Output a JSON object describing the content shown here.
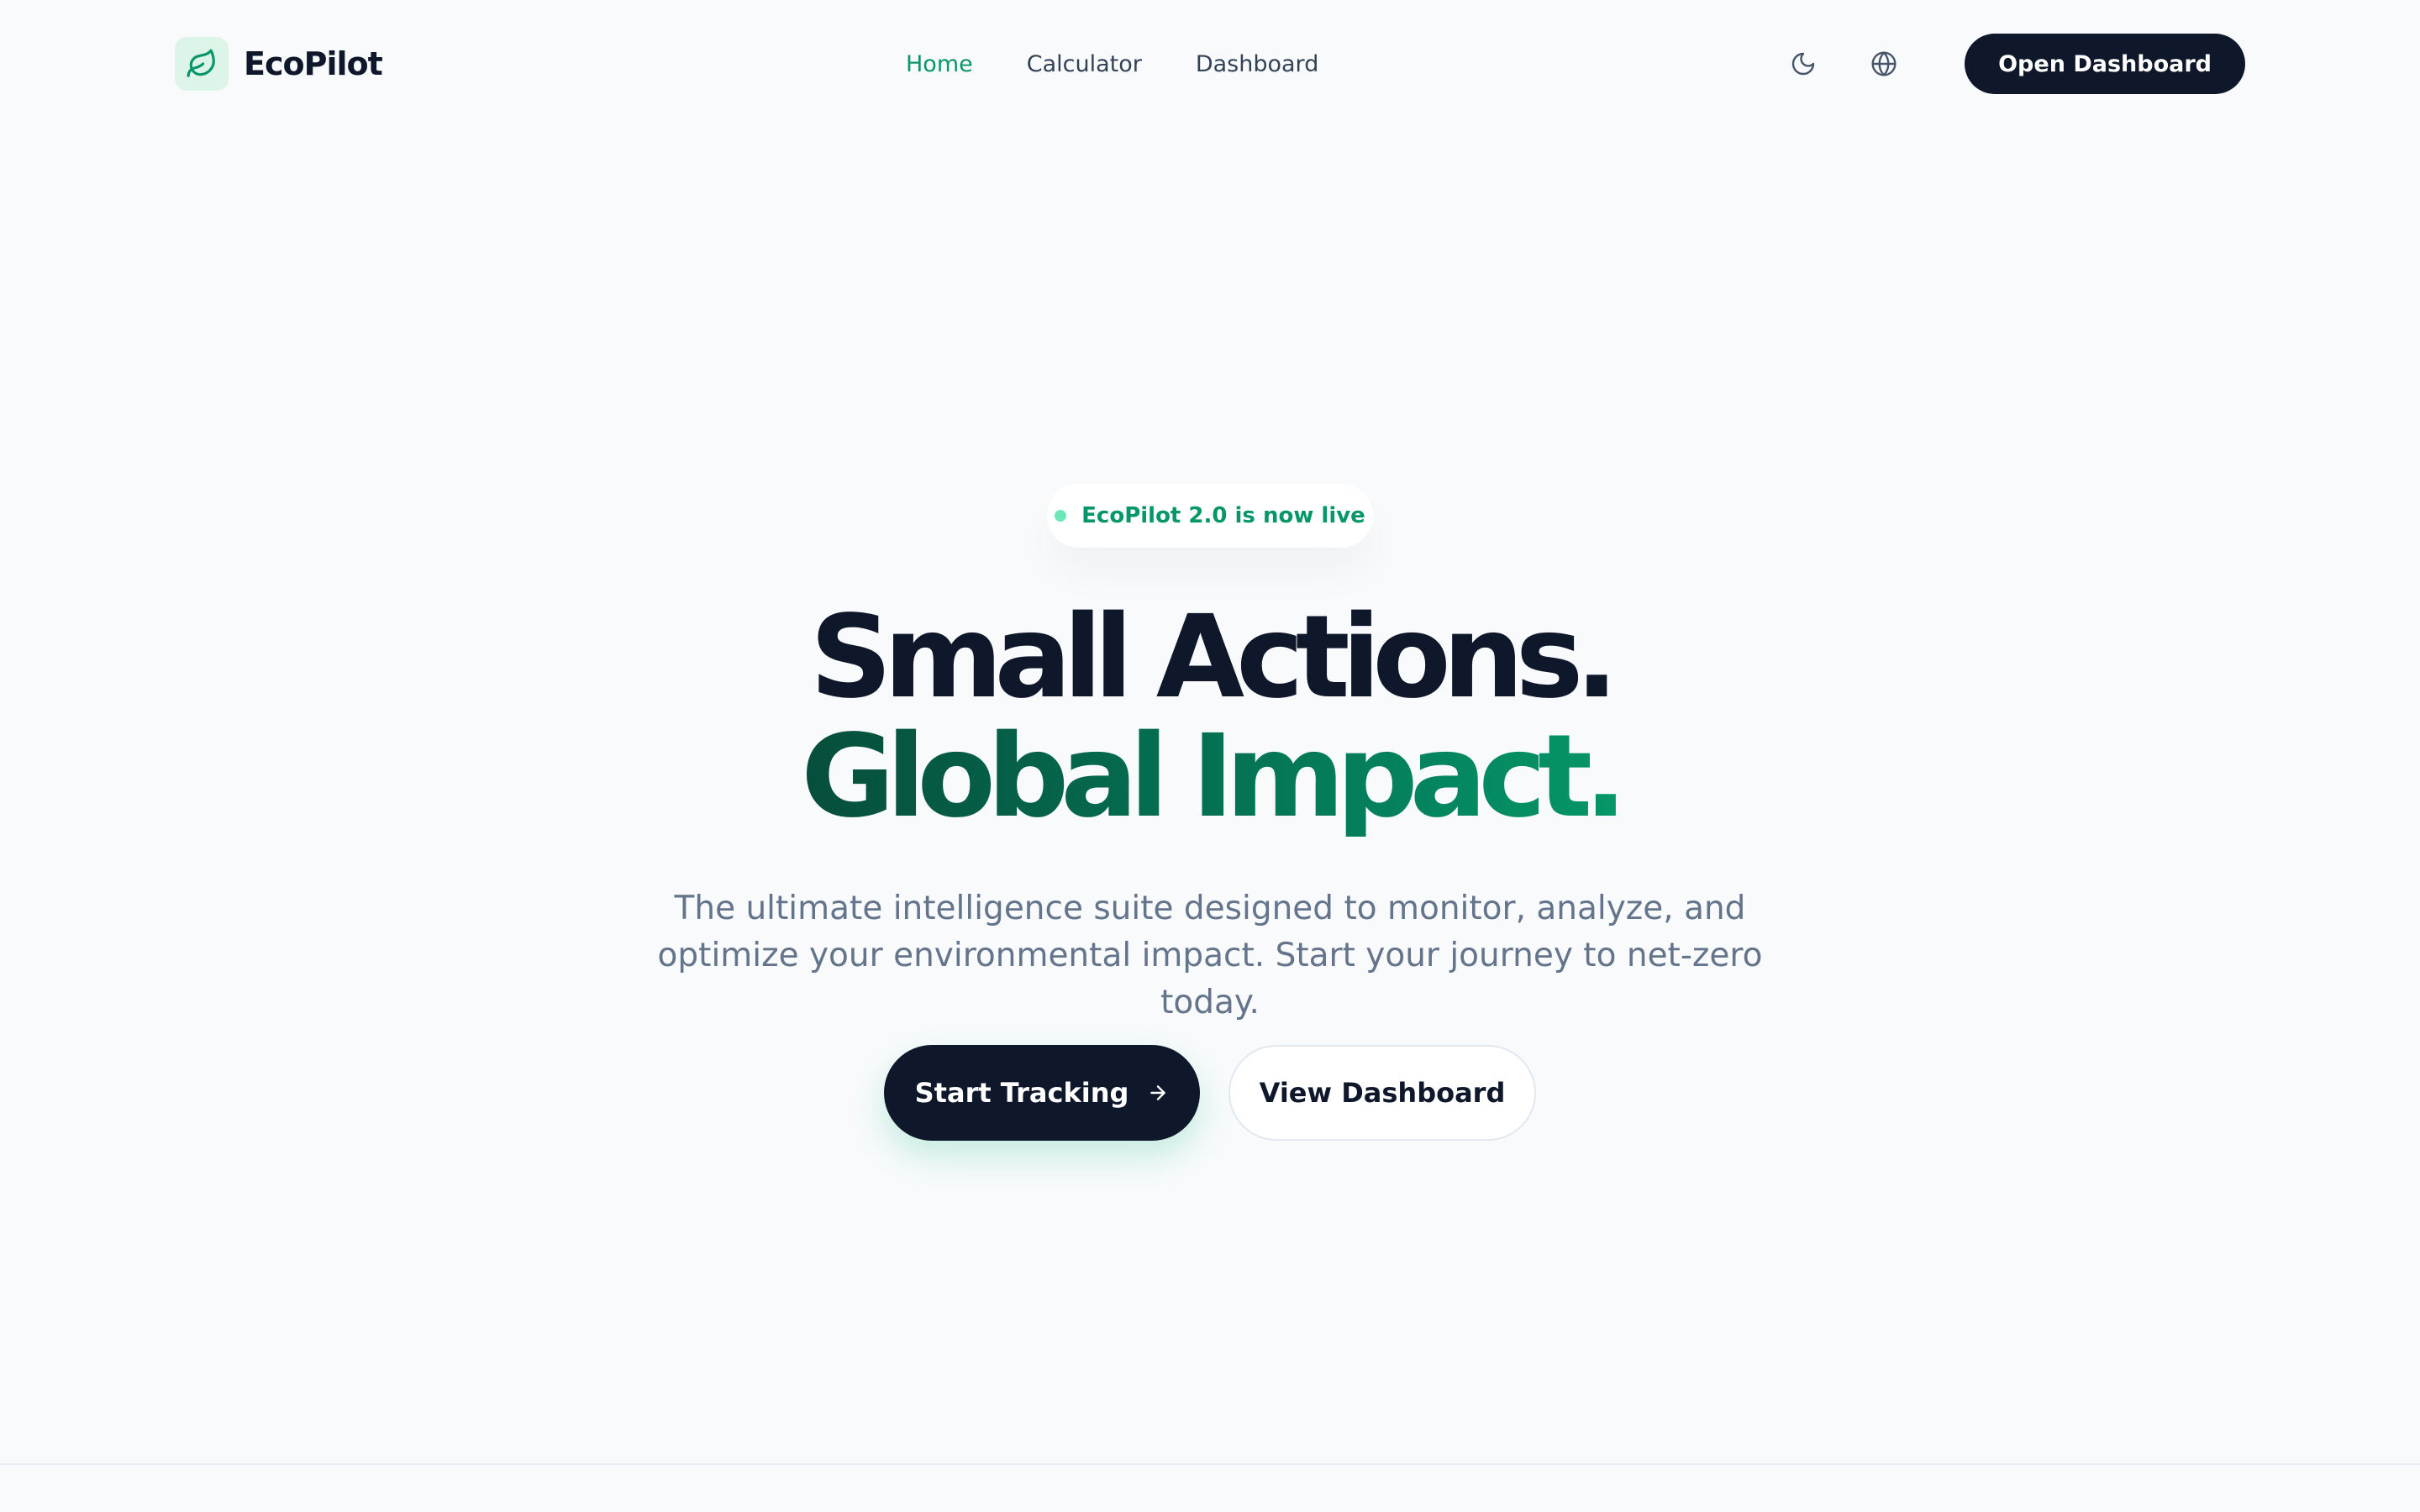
{
  "header": {
    "brand_name": "EcoPilot",
    "brand_icon": "leaf-icon",
    "nav": [
      {
        "label": "Home",
        "active": true
      },
      {
        "label": "Calculator",
        "active": false
      },
      {
        "label": "Dashboard",
        "active": false
      }
    ],
    "theme_icon": "moon-icon",
    "language_icon": "globe-icon",
    "open_dashboard_label": "Open Dashboard"
  },
  "hero": {
    "badge_text": "EcoPilot 2.0 is now live",
    "headline_line1": "Small Actions.",
    "headline_line2": "Global Impact.",
    "subtitle": "The ultimate intelligence suite designed to monitor, analyze, and optimize your environmental impact. Start your journey to net-zero today.",
    "primary_cta_label": "Start Tracking",
    "primary_cta_icon": "arrow-right-icon",
    "secondary_cta_label": "View Dashboard"
  },
  "colors": {
    "background": "#f8fafc",
    "ink": "#0f172a",
    "accent_green": "#059669",
    "accent_green_dark": "#064e3b",
    "muted_text": "#64748b",
    "badge_dot": "#6ee7b7"
  }
}
